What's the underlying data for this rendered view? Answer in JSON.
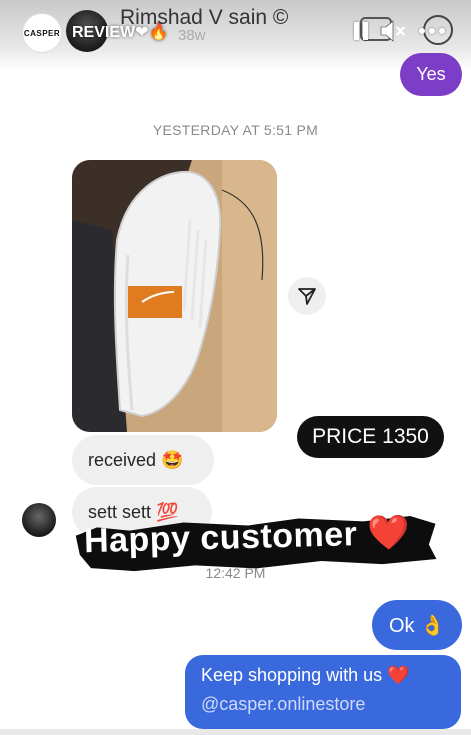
{
  "header": {
    "brand_logo_text": "CASPER",
    "story_label": "REVIEW❤🔥",
    "chat_title": "Rimshad V sain ©",
    "chat_subtitle": "38w"
  },
  "messages": {
    "yes": "Yes",
    "timestamp_1": "YESTERDAY AT 5:51 PM",
    "price_badge": "PRICE 1350",
    "received": "received 🤩",
    "sett": "sett sett 💯",
    "overlay_caption": "Happy customer ❤️",
    "timestamp_2": "12:42 PM",
    "ok": "Ok 👌",
    "keep_shopping": "Keep shopping with us ❤️",
    "store_handle": "@casper.onlinestore"
  },
  "colors": {
    "outgoing_purple": "#7d3ec7",
    "outgoing_blue": "#3a68dd",
    "incoming_gray": "#efefef"
  }
}
